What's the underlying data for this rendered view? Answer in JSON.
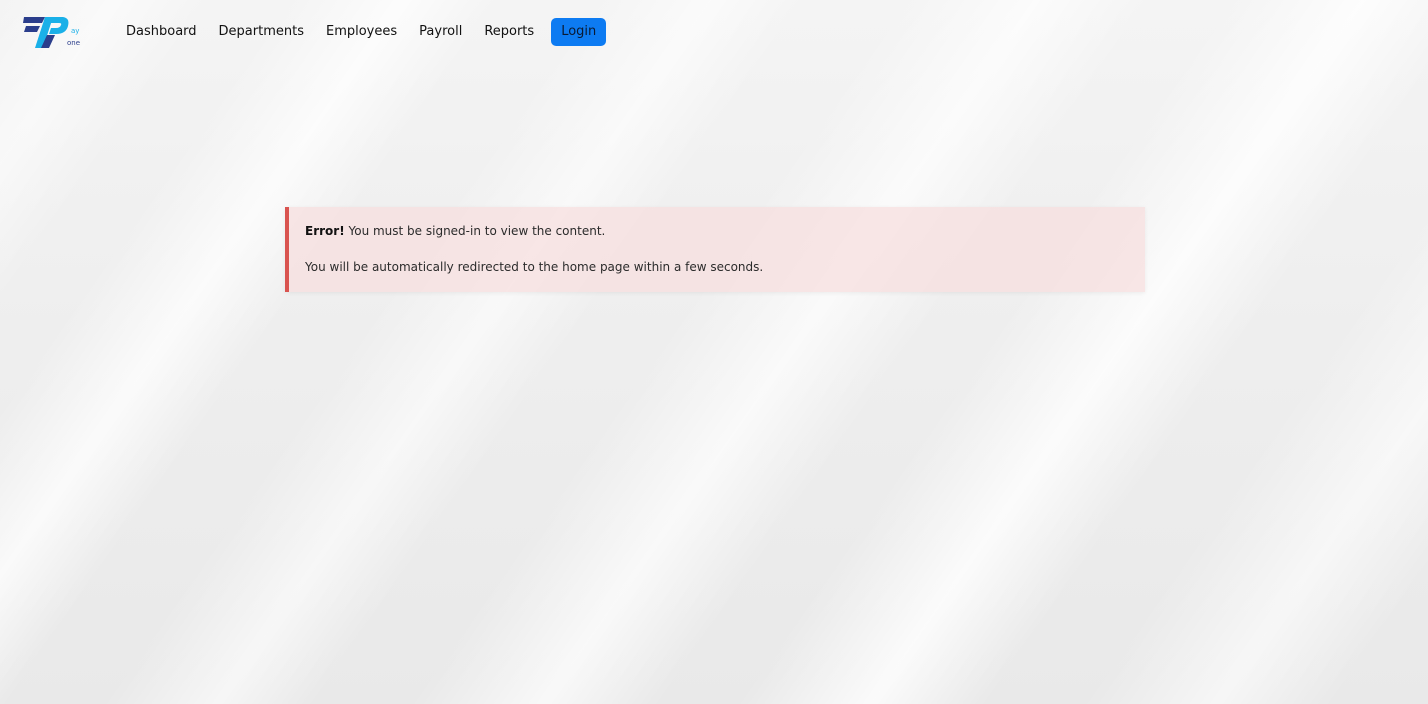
{
  "navbar": {
    "logo": {
      "icon": "payone-logo-icon",
      "text_top": "ay",
      "text_bottom": "one",
      "colors": {
        "navy": "#2b3e8c",
        "cyan": "#1ab0e8"
      }
    },
    "links": [
      {
        "label": "Dashboard"
      },
      {
        "label": "Departments"
      },
      {
        "label": "Employees"
      },
      {
        "label": "Payroll"
      },
      {
        "label": "Reports"
      }
    ],
    "login_label": "Login",
    "login_color": "#0d7bf2"
  },
  "alert": {
    "strong": "Error!",
    "message": " You must be signed-in to view the content.",
    "redirect": "You will be automatically redirected to the home page within a few seconds.",
    "accent_color": "#d9534f",
    "background_color": "#f6dede"
  }
}
